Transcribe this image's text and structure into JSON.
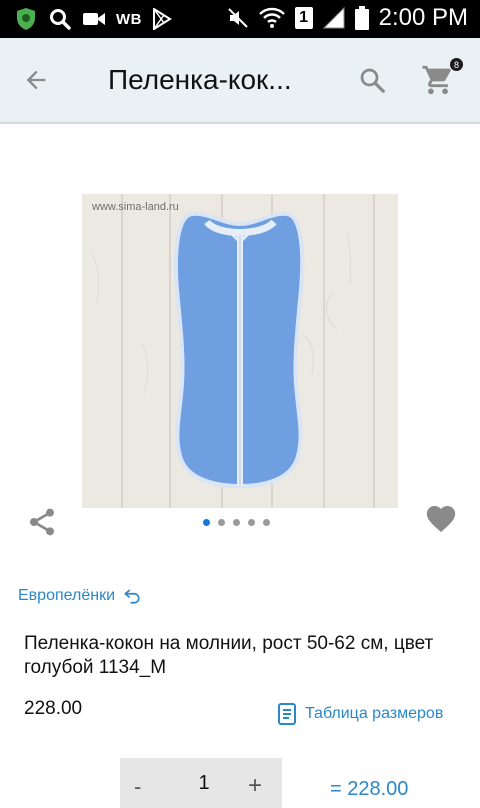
{
  "status_bar": {
    "carrier_label": "WB",
    "sim_slot": "1",
    "time": "2:00 PM"
  },
  "app_bar": {
    "title": "Пеленка-кок...",
    "cart_count": "8"
  },
  "product": {
    "watermark": "www.sima-land.ru",
    "image_count": 5,
    "active_image": 1,
    "brand": "Европелёнки",
    "title": "Пеленка-кокон на молнии, рост 50-62 см, цвет голубой 1134_М",
    "price": "228.00",
    "size_table_label": "Таблица размеров",
    "quantity_minus": "-",
    "quantity": "1",
    "quantity_plus": "+",
    "total": "= 228.00"
  },
  "colors": {
    "app_bar_bg": "#e9f1f5",
    "link": "#2a88c8",
    "active_dot": "#1976d2",
    "product_fabric": "#6f9fe0"
  },
  "icons": [
    "shield-app-icon",
    "search-icon",
    "video-camera-icon",
    "play-store-icon",
    "mute-icon",
    "wifi-icon",
    "signal-icon",
    "battery-icon",
    "back-arrow-icon",
    "search-icon",
    "cart-icon",
    "share-icon",
    "heart-icon",
    "undo-icon",
    "document-icon"
  ]
}
